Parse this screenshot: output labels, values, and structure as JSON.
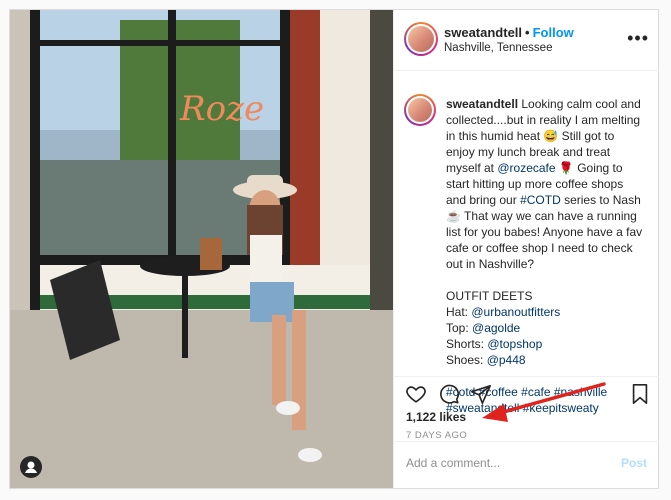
{
  "post": {
    "username": "sweatandtell",
    "follow_label": "Follow",
    "separator": "•",
    "location": "Nashville, Tennessee",
    "more_glyph": "•••",
    "caption": {
      "username": "sweatandtell",
      "line1": " Looking calm cool and collected....but in reality I am melting in this humid heat 😅 Still got to enjoy my lunch break and treat myself at ",
      "mention_cafe": "@rozecafe",
      "line2": " 🌹 Going to start hitting up more coffee shops and bring our ",
      "hashtag_cotd": "#COTD",
      "line3": " series to Nash ☕ That way we can have a running list for you babes! Anyone have a fav cafe or coffee shop I need to check out in Nashville?",
      "outfit_heading": "OUTFIT DEETS",
      "hat_label": "Hat: ",
      "hat_value": "@urbanoutfitters",
      "top_label": "Top: ",
      "top_value": "@agolde",
      "shorts_label": "Shorts: ",
      "shorts_value": "@topshop",
      "shoes_label": "Shoes: ",
      "shoes_value": "@p448",
      "tags_line1": "#cotd #coffee #cafe #nashville",
      "tags_line2": "#sweatandtell #keepitsweaty"
    },
    "likes": "1,122 likes",
    "date": "7 DAYS AGO",
    "comment_placeholder": "Add a comment...",
    "post_label": "Post",
    "photo_sign_text": "Roze",
    "colors": {
      "accent": "#0095f6",
      "link": "#00376b",
      "arrow": "#e0231c"
    }
  }
}
